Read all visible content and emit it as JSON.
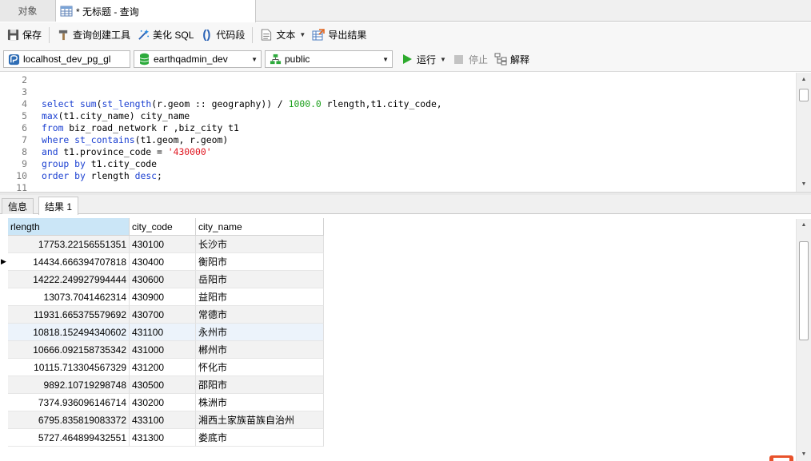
{
  "tabs": {
    "objects": "对象",
    "query": "* 无标题 - 查询"
  },
  "toolbar": {
    "save": "保存",
    "query_builder": "查询创建工具",
    "beautify_sql": "美化 SQL",
    "code_snippet": "代码段",
    "text": "文本",
    "export_results": "导出结果"
  },
  "selectors": {
    "connection": "localhost_dev_pg_gl",
    "database": "earthqadmin_dev",
    "schema": "public",
    "run": "运行",
    "stop": "停止",
    "explain": "解释"
  },
  "editor": {
    "line_numbers": [
      "2",
      "3",
      "4",
      "5",
      "6",
      "7",
      "8",
      "9",
      "10",
      "11"
    ],
    "lines": [
      "",
      "",
      "select sum(st_length(r.geom :: geography)) / 1000.0 rlength,t1.city_code,",
      "max(t1.city_name) city_name",
      "from biz_road_network r ,biz_city t1",
      "where st_contains(t1.geom, r.geom)",
      "and t1.province_code = '430000'",
      "group by t1.city_code",
      "order by rlength desc;",
      ""
    ]
  },
  "result_tabs": {
    "info": "信息",
    "result": "结果 1"
  },
  "grid": {
    "columns": [
      "rlength",
      "city_code",
      "city_name"
    ],
    "rows": [
      [
        "17753.22156551351",
        "430100",
        "长沙市"
      ],
      [
        "14434.666394707818",
        "430400",
        "衡阳市"
      ],
      [
        "14222.249927994444",
        "430600",
        "岳阳市"
      ],
      [
        "13073.7041462314",
        "430900",
        "益阳市"
      ],
      [
        "11931.665375579692",
        "430700",
        "常德市"
      ],
      [
        "10818.152494340602",
        "431100",
        "永州市"
      ],
      [
        "10666.092158735342",
        "431000",
        "郴州市"
      ],
      [
        "10115.713304567329",
        "431200",
        "怀化市"
      ],
      [
        "9892.10719298748",
        "430500",
        "邵阳市"
      ],
      [
        "7374.936096146714",
        "430200",
        "株洲市"
      ],
      [
        "6795.835819083372",
        "433100",
        "湘西土家族苗族自治州"
      ],
      [
        "5727.464899432551",
        "431300",
        "娄底市"
      ]
    ],
    "current_row_index": 1
  }
}
